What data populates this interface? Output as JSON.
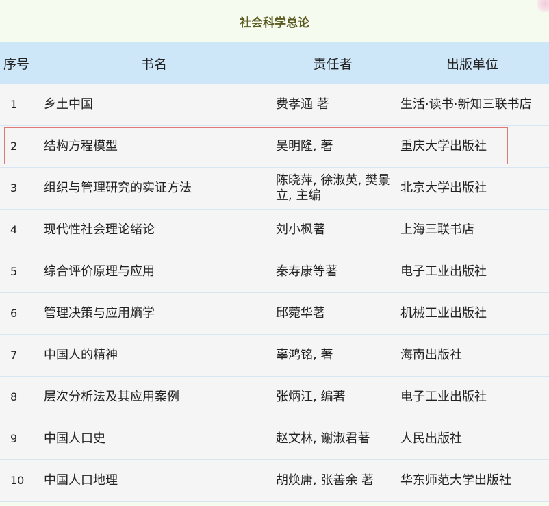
{
  "title": "社会科学总论",
  "columns": [
    "序号",
    "书名",
    "责任者",
    "出版单位"
  ],
  "rows": [
    {
      "no": "1",
      "name": "乡土中国",
      "resp": "费孝通 著",
      "pub": "生活·读书·新知三联书店"
    },
    {
      "no": "2",
      "name": "结构方程模型",
      "resp": "吴明隆, 著",
      "pub": "重庆大学出版社"
    },
    {
      "no": "3",
      "name": "组织与管理研究的实证方法",
      "resp": "陈晓萍, 徐淑英, 樊景立, 主编",
      "pub": "北京大学出版社"
    },
    {
      "no": "4",
      "name": "现代性社会理论绪论",
      "resp": "刘小枫著",
      "pub": "上海三联书店"
    },
    {
      "no": "5",
      "name": "综合评价原理与应用",
      "resp": "秦寿康等著",
      "pub": "电子工业出版社"
    },
    {
      "no": "6",
      "name": "管理决策与应用熵学",
      "resp": "邱菀华著",
      "pub": "机械工业出版社"
    },
    {
      "no": "7",
      "name": "中国人的精神",
      "resp": "辜鸿铭, 著",
      "pub": "海南出版社"
    },
    {
      "no": "8",
      "name": "层次分析法及其应用案例",
      "resp": "张炳江, 编著",
      "pub": "电子工业出版社"
    },
    {
      "no": "9",
      "name": "中国人口史",
      "resp": "赵文林, 谢淑君著",
      "pub": "人民出版社"
    },
    {
      "no": "10",
      "name": "中国人口地理",
      "resp": "胡焕庸, 张善余 著",
      "pub": "华东师范大学出版社"
    }
  ],
  "highlight_row": 2
}
